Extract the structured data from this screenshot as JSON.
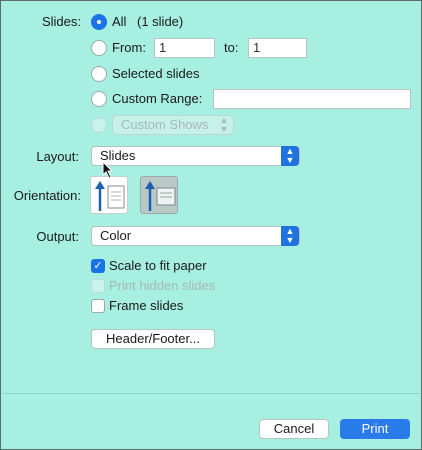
{
  "slides": {
    "label": "Slides:",
    "all_label": "All",
    "all_count": "(1 slide)",
    "from_label": "From:",
    "from_value": "1",
    "to_label": "to:",
    "to_value": "1",
    "selected_label": "Selected slides",
    "custom_range_label": "Custom Range:",
    "custom_range_value": "",
    "custom_shows_label": "Custom Shows"
  },
  "layout": {
    "label": "Layout:",
    "value": "Slides"
  },
  "orientation": {
    "label": "Orientation:",
    "options": [
      {
        "name": "portrait",
        "icon": "portrait-orientation-icon"
      },
      {
        "name": "landscape",
        "icon": "landscape-orientation-icon"
      }
    ]
  },
  "output": {
    "label": "Output:",
    "value": "Color"
  },
  "options": {
    "scale_to_fit": {
      "label": "Scale to fit paper",
      "checked": true
    },
    "print_hidden": {
      "label": "Print hidden slides",
      "checked": false,
      "disabled": true
    },
    "frame_slides": {
      "label": "Frame slides",
      "checked": false
    }
  },
  "header_footer_label": "Header/Footer...",
  "footer": {
    "cancel_label": "Cancel",
    "print_label": "Print"
  },
  "colors": {
    "panel_bg": "#a6efe1",
    "accent": "#1a73e8",
    "disabled_text": "#a7b9b5"
  }
}
